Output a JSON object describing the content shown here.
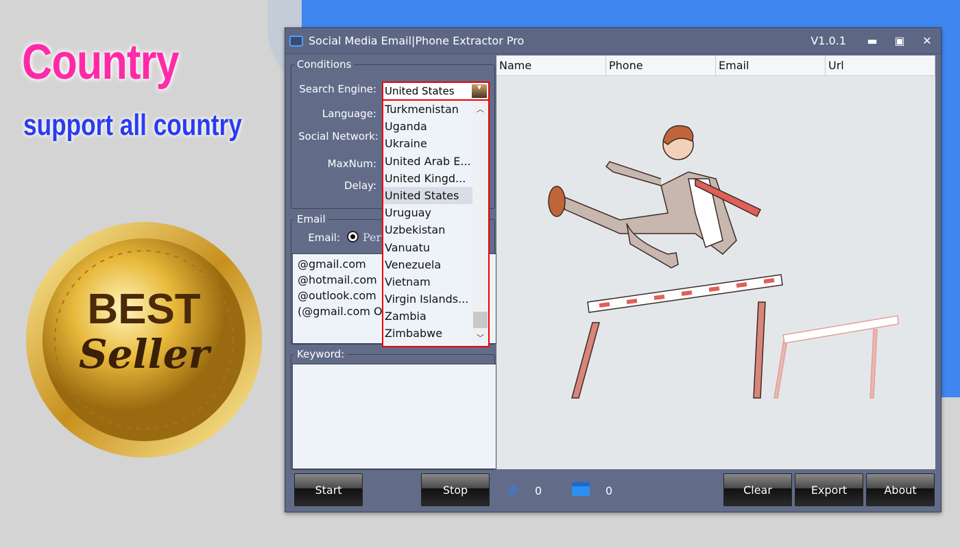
{
  "promo": {
    "headline": "Country",
    "subline": "support all country",
    "badge_top": "BEST",
    "badge_script": "Seller"
  },
  "window": {
    "title": "Social Media Email|Phone Extractor Pro",
    "version": "V1.0.1",
    "minimize": "▬",
    "maximize": "▣",
    "close": "✕"
  },
  "conditions": {
    "legend": "Conditions",
    "search_engine_label": "Search Engine:",
    "language_label": "Language:",
    "social_network_label": "Social Network:",
    "maxnum_label": "MaxNum:",
    "delay_label": "Delay:",
    "selected_country": "United States",
    "options": [
      "Turkmenistan",
      "Uganda",
      "Ukraine",
      "United Arab E...",
      "United Kingd...",
      "United States",
      "Uruguay",
      "Uzbekistan",
      "Vanuatu",
      "Venezuela",
      "Vietnam",
      "Virgin Islands...",
      "Zambia",
      "Zimbabwe"
    ]
  },
  "email": {
    "legend": "Email",
    "label": "Email:",
    "radio_label": "Pers",
    "domains": [
      "@gmail.com",
      "@hotmail.com",
      "@outlook.com",
      "(@gmail.com OR"
    ]
  },
  "keyword": {
    "legend": "Keyword:"
  },
  "table": {
    "columns": [
      "Name",
      "Phone",
      "Email",
      "Url"
    ]
  },
  "footer": {
    "start": "Start",
    "stop": "Stop",
    "link_count": "0",
    "mail_count": "0",
    "clear": "Clear",
    "export": "Export",
    "about": "About"
  }
}
